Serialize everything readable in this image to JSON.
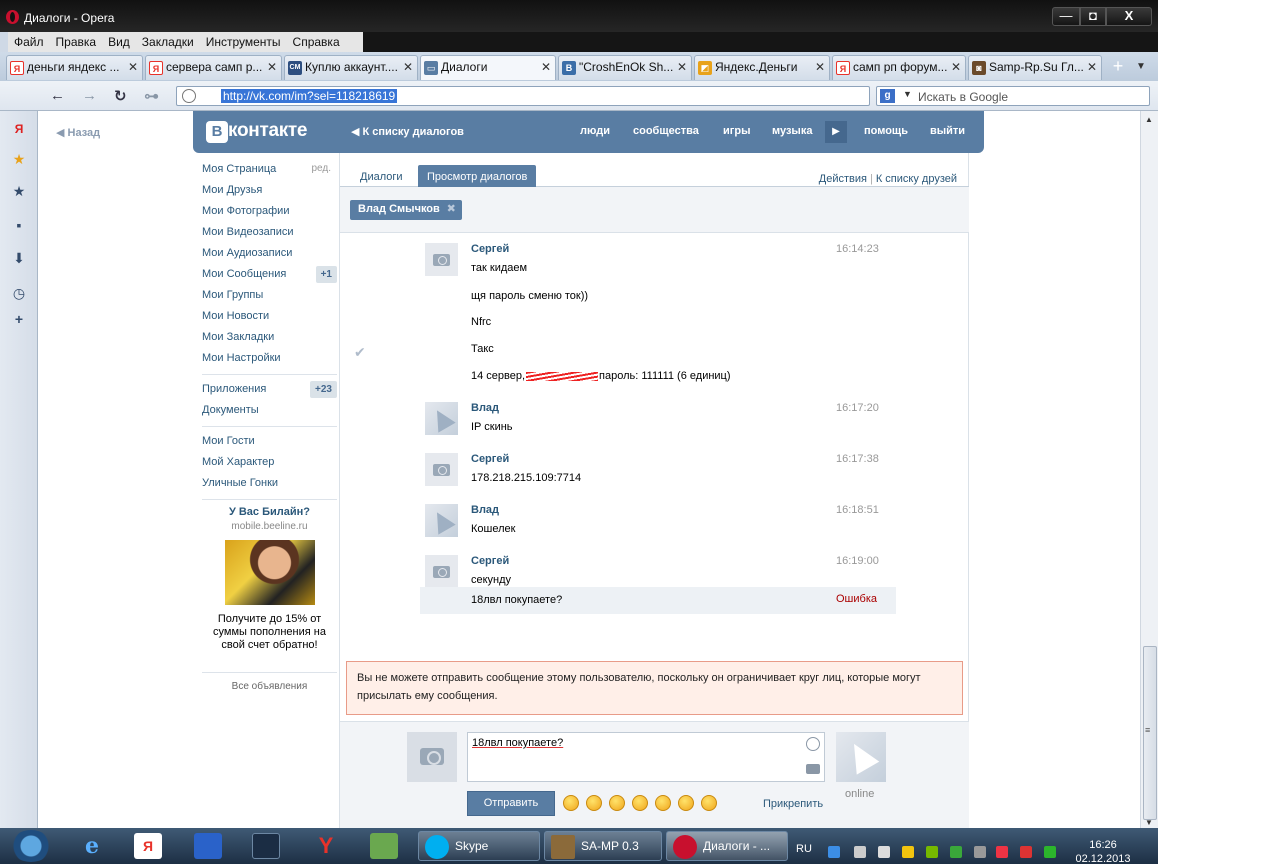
{
  "window": {
    "title": "Диалоги - Opera",
    "min_label": "—",
    "max_label": "◘",
    "close_label": "X"
  },
  "menu": [
    "Файл",
    "Правка",
    "Вид",
    "Закладки",
    "Инструменты",
    "Справка"
  ],
  "tabs": [
    {
      "label": "деньги яндекс ...",
      "icon": "yandex-icon",
      "icon_text": "Я",
      "color": "#e8322a"
    },
    {
      "label": "сервера самп р...",
      "icon": "yandex-icon",
      "icon_text": "Я",
      "color": "#e8322a"
    },
    {
      "label": "Куплю аккаунт....",
      "icon": "forum-icon",
      "icon_text": "CM",
      "color": "#2d4e80"
    },
    {
      "label": "Диалоги",
      "icon": "vk-icon",
      "icon_text": "▭",
      "color": "#597da3"
    },
    {
      "label": "\"CroshEnOk Sh...",
      "icon": "vk-icon",
      "icon_text": "B",
      "color": "#3b6ea8"
    },
    {
      "label": "Яндекс.Деньги",
      "icon": "yandex-money-icon",
      "icon_text": "◩",
      "color": "#e8a21a"
    },
    {
      "label": "самп рп форум...",
      "icon": "yandex-icon",
      "icon_text": "Я",
      "color": "#e8322a"
    },
    {
      "label": "Samp-Rp.Su Гл...",
      "icon": "samp-icon",
      "icon_text": "◙",
      "color": "#6b4a2a"
    }
  ],
  "tab_close": "✕",
  "tab_add": "+",
  "tab_menu": "▼",
  "address": {
    "url": "http://vk.com/im?sel=118218619",
    "search_placeholder": "Искать в Google",
    "search_engine_letter": "g",
    "search_arrow": "▼"
  },
  "nav": {
    "back": "←",
    "forward": "→",
    "reload": "↻",
    "key": "⊶"
  },
  "sidepanel_icons": [
    {
      "name": "yandex-panel-icon",
      "glyph": "Я",
      "color": "#d22"
    },
    {
      "name": "star-icon",
      "glyph": "★",
      "color": "#e8a21a"
    },
    {
      "name": "bookmarks-star-icon",
      "glyph": "★",
      "color": "#334b6b"
    },
    {
      "name": "notes-icon",
      "glyph": "▪",
      "color": "#334b6b"
    },
    {
      "name": "downloads-icon",
      "glyph": "⬇",
      "color": "#334b6b"
    },
    {
      "name": "history-clock-icon",
      "glyph": "◷",
      "color": "#334b6b"
    },
    {
      "name": "add-panel-icon",
      "glyph": "+",
      "color": "#334b6b"
    }
  ],
  "vk": {
    "back_link": "Назад",
    "logo_letter": "В",
    "logo_text": "контакте",
    "to_dialogs": "К списку диалогов",
    "nav": [
      "люди",
      "сообщества",
      "игры",
      "музыка"
    ],
    "nav_right": [
      "помощь",
      "выйти"
    ],
    "play": "▶"
  },
  "left_menu": [
    {
      "label": "Моя Страница",
      "aside": "ред."
    },
    {
      "label": "Мои Друзья"
    },
    {
      "label": "Мои Фотографии"
    },
    {
      "label": "Мои Видеозаписи"
    },
    {
      "label": "Мои Аудиозаписи"
    },
    {
      "label": "Мои Сообщения",
      "badge": "+1"
    },
    {
      "label": "Мои Группы"
    },
    {
      "label": "Мои Новости"
    },
    {
      "label": "Мои Закладки"
    },
    {
      "label": "Мои Настройки"
    }
  ],
  "left_menu2": [
    {
      "label": "Приложения",
      "badge": "+23"
    },
    {
      "label": "Документы"
    }
  ],
  "left_menu3": [
    {
      "label": "Мои Гости"
    },
    {
      "label": "Мой Характер"
    },
    {
      "label": "Уличные Гонки"
    }
  ],
  "ad": {
    "title": "У Вас Билайн?",
    "site": "mobile.beeline.ru",
    "text": "Получите до 15% от суммы пополнения на свой счет обратно!",
    "all": "Все объявления"
  },
  "dialog": {
    "tab_dialogs": "Диалоги",
    "tab_view": "Просмотр диалогов",
    "actions": "Действия",
    "actions_sep": "|",
    "to_friends": "К списку друзей",
    "peer": "Влад Смычков",
    "peer_close": "✖",
    "check": "✔",
    "messages": [
      {
        "author": "Сергей",
        "time": "16:14:23",
        "avatar": "cam",
        "lines": [
          "так кидаем",
          "щя пароль сменю ток))",
          "Nfrc",
          "Такс"
        ],
        "extra_before": "14 сервер,",
        "extra_after": "пароль: 111111 (6 единиц)"
      },
      {
        "author": "Влад",
        "time": "16:17:20",
        "avatar": "pizza",
        "lines": [
          "IP скинь"
        ]
      },
      {
        "author": "Сергей",
        "time": "16:17:38",
        "avatar": "cam",
        "lines": [
          "178.218.215.109:7714"
        ]
      },
      {
        "author": "Влад",
        "time": "16:18:51",
        "avatar": "pizza",
        "lines": [
          "Кошелек"
        ]
      },
      {
        "author": "Сергей",
        "time": "16:19:00",
        "avatar": "cam",
        "lines": [
          "секунду"
        ]
      }
    ],
    "failed_text": "18лвл покупаете?",
    "failed_status": "Ошибка",
    "warning": "Вы не можете отправить сообщение этому пользователю, поскольку он ограничивает круг лиц, которые могут присылать ему сообщения.",
    "composer_text": "18лвл покупаете?",
    "online": "online",
    "send": "Отправить",
    "attach": "Прикрепить"
  },
  "taskbar": {
    "skype": "Skype",
    "samp": "SA-MP 0.3",
    "opera": "Диалоги - ...",
    "lang": "RU",
    "time": "16:26",
    "date": "02.12.2013"
  }
}
